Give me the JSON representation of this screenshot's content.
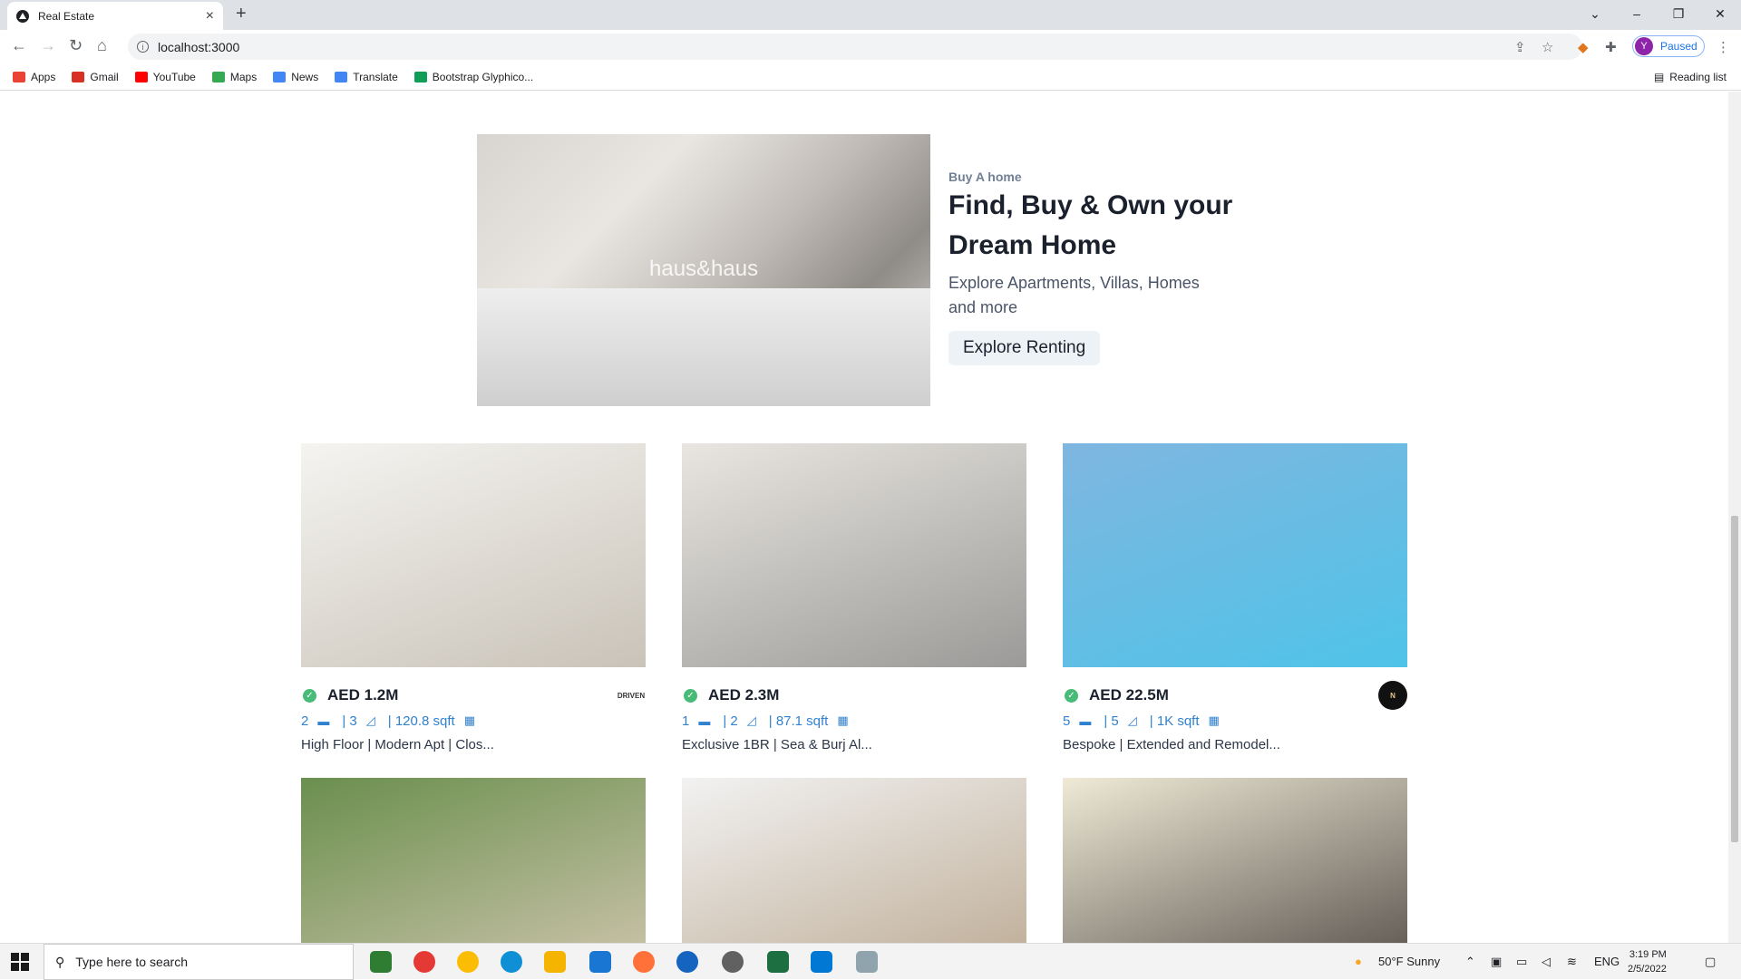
{
  "browser": {
    "tab_title": "Real Estate",
    "new_tab": "+",
    "url": "localhost:3000",
    "profile_initial": "Y",
    "profile_status": "Paused",
    "bookmarks": [
      {
        "label": "Apps",
        "color": "#ea4335"
      },
      {
        "label": "Gmail",
        "color": "#d93025"
      },
      {
        "label": "YouTube",
        "color": "#ff0000"
      },
      {
        "label": "Maps",
        "color": "#34a853"
      },
      {
        "label": "News",
        "color": "#4285f4"
      },
      {
        "label": "Translate",
        "color": "#4285f4"
      },
      {
        "label": "Bootstrap Glyphico...",
        "color": "#0f9d58"
      }
    ],
    "reading_list": "Reading list"
  },
  "hero": {
    "eyebrow": "Buy A home",
    "heading_line1": "Find, Buy & Own your",
    "heading_line2": "Dream Home",
    "subtitle": "Explore Apartments, Villas, Homes and more",
    "button": "Explore Renting",
    "watermark": "haus&haus"
  },
  "listings": [
    {
      "price": "AED 1.2M",
      "beds": "2",
      "baths": "| 3",
      "area": "| 120.8 sqft",
      "title": "High Floor | Modern Apt | Clos...",
      "agency": "DRIVEN",
      "agency_bg": "#ffffff",
      "agency_fg": "#333333",
      "img_from": "#f5f4f1",
      "img_to": "#c9c3b8"
    },
    {
      "price": "AED 2.3M",
      "beds": "1",
      "baths": "| 2",
      "area": "| 87.1 sqft",
      "title": "Exclusive 1BR | Sea & Burj Al...",
      "agency": "",
      "agency_bg": "#ffffff",
      "agency_fg": "#8bc34a",
      "img_from": "#e9e6e1",
      "img_to": "#9b9a98"
    },
    {
      "price": "AED 22.5M",
      "beds": "5",
      "baths": "| 5",
      "area": "| 1K sqft",
      "title": "Bespoke | Extended and Remodel...",
      "agency": "N",
      "agency_bg": "#111111",
      "agency_fg": "#e8c48a",
      "img_from": "#7fb6e0",
      "img_to": "#4fc3e8"
    },
    {
      "price": "",
      "beds": "",
      "baths": "",
      "area": "",
      "title": "",
      "agency": "",
      "agency_bg": "#ffffff",
      "agency_fg": "#000000",
      "img_from": "#6a8f4e",
      "img_to": "#d6c9b4"
    },
    {
      "price": "",
      "beds": "",
      "baths": "",
      "area": "",
      "title": "",
      "agency": "",
      "agency_bg": "#ffffff",
      "agency_fg": "#000000",
      "img_from": "#f2f2f2",
      "img_to": "#b8a58c"
    },
    {
      "price": "",
      "beds": "",
      "baths": "",
      "area": "",
      "title": "",
      "agency": "",
      "agency_bg": "#ffffff",
      "agency_fg": "#000000",
      "img_from": "#efe9d6",
      "img_to": "#4a4540"
    }
  ],
  "taskbar": {
    "search_placeholder": "Type here to search",
    "weather": "50°F  Sunny",
    "language": "ENG",
    "time": "3:19 PM",
    "date": "2/5/2022"
  }
}
